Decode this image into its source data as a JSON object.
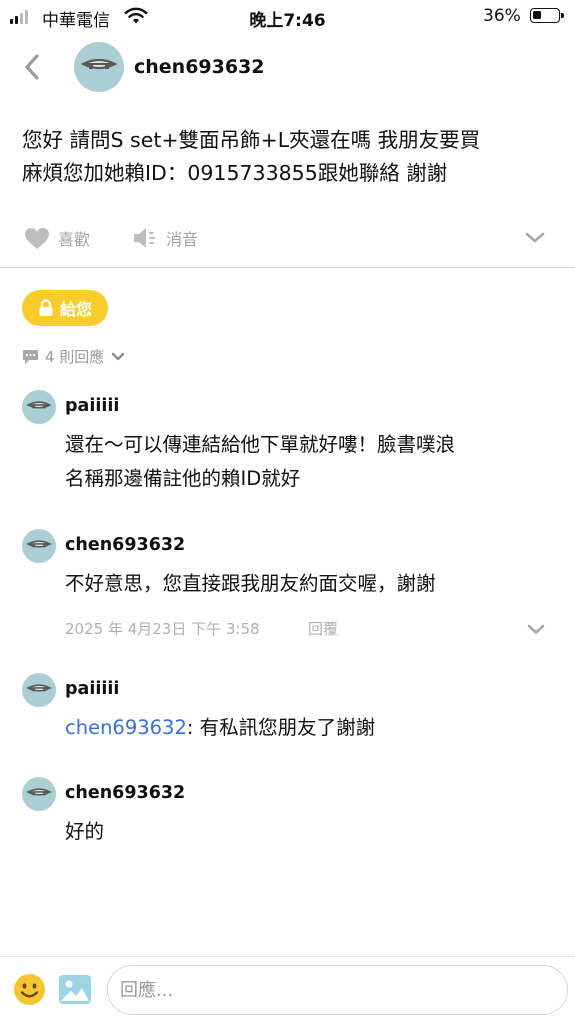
{
  "status_bar": {
    "carrier": "中華電信",
    "time": "晚上7:46",
    "battery_percent": "36%",
    "battery_level": 0.36,
    "signal_bars_filled": 2
  },
  "header": {
    "username": "chen693632",
    "avatar_icon": "closed-eyes-avatar-icon",
    "back_icon": "chevron-left-icon"
  },
  "post": {
    "body_line1": "您好 請問S set+雙面吊飾+L夾還在嗎 我朋友要買",
    "body_line2": "麻煩您加她賴ID：0915733855跟她聯絡 謝謝",
    "like_label": "喜歡",
    "mute_label": "消音",
    "gift_label": "給您"
  },
  "reply_count_label": "4 則回應",
  "comments": [
    {
      "user": "paiiiii",
      "line1": "還在～可以傳連結給他下單就好嘍！臉書噗浪",
      "line2": "名稱那邊備註他的賴ID就好"
    },
    {
      "user": "chen693632",
      "text": "不好意思，您直接跟我朋友約面交喔，謝謝",
      "timestamp": "2025 年 4月23日  下午 3:58",
      "reply_label": "回覆"
    },
    {
      "user": "paiiiii",
      "mention": "chen693632",
      "text": ": 有私訊您朋友了謝謝"
    },
    {
      "user": "chen693632",
      "text": "好的"
    }
  ],
  "composer": {
    "placeholder": "回應..."
  },
  "colors": {
    "accent_yellow": "#f8cd2b",
    "avatar_bg": "#a9cfd5",
    "mention_blue": "#3a6fd8",
    "muted_gray": "#a3a3a3"
  }
}
